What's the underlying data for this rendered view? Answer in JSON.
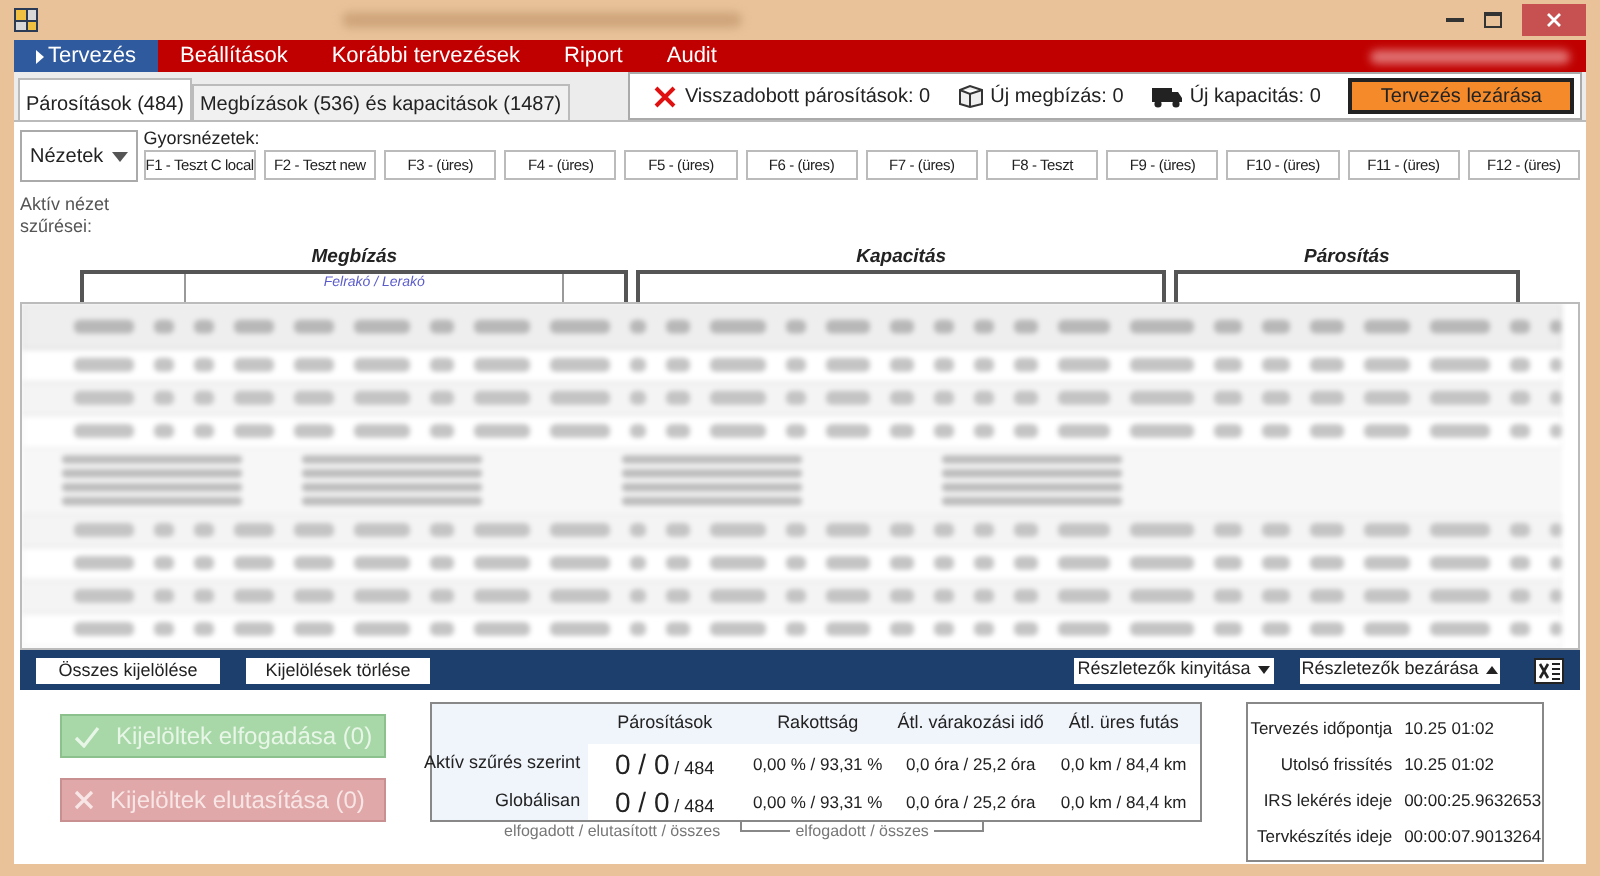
{
  "menu": [
    {
      "label": "Tervezés",
      "selected": true
    },
    {
      "label": "Beállítások",
      "selected": false
    },
    {
      "label": "Korábbi tervezések",
      "selected": false
    },
    {
      "label": "Riport",
      "selected": false
    },
    {
      "label": "Audit",
      "selected": false
    }
  ],
  "tabs": [
    {
      "label": "Párosítások (484)",
      "selected": true
    },
    {
      "label": "Megbízások (536) és kapacitások (1487)",
      "selected": false
    }
  ],
  "status": {
    "rejected": "Visszadobott párosítások: 0",
    "new_orders": "Új megbízás: 0",
    "new_capacity": "Új kapacitás: 0",
    "close_button": "Tervezés lezárása"
  },
  "views": {
    "dropdown": "Nézetek",
    "quick_label": "Gyorsnézetek:",
    "quick": [
      "F1 - Teszt C local",
      "F2 - Teszt new",
      "F3 - (üres)",
      "F4 - (üres)",
      "F5 - (üres)",
      "F6 - (üres)",
      "F7 - (üres)",
      "F8 - Teszt",
      "F9 - (üres)",
      "F10 - (üres)",
      "F11 - (üres)",
      "F12 - (üres)"
    ],
    "active_filters": "Aktív nézet szűrései:"
  },
  "groups": [
    "Megbízás",
    "Kapacitás",
    "Párosítás"
  ],
  "subgroup": "Felrakó / Lerakó",
  "toolbar": {
    "select_all": "Összes kijelölése",
    "clear_selection": "Kijelölések törlése",
    "expand": "Részletezők kinyitása",
    "collapse": "Részletezők bezárása"
  },
  "actions": [
    {
      "label": "Kijelöltek elfogadása (0)",
      "kind": "accept",
      "disabled": true
    },
    {
      "label": "Kijelöltek elutasítása (0)",
      "kind": "reject",
      "disabled": true
    }
  ],
  "stats": {
    "columns": [
      "Párosítások",
      "Rakottság",
      "Átl. várakozási idő",
      "Átl. üres futás"
    ],
    "rows": [
      {
        "label": "Aktív szűrés szerint",
        "count": "0 / 0",
        "total": "/ 484",
        "load": "0,00 % / 93,31 %",
        "wait": "0,0 óra / 25,2 óra",
        "empty": "0,0 km / 84,4 km"
      },
      {
        "label": "Globálisan",
        "count": "0 / 0",
        "total": "/ 484",
        "load": "0,00 % / 93,31 %",
        "wait": "0,0 óra / 25,2 óra",
        "empty": "0,0 km / 84,4 km"
      }
    ],
    "legend_left": "elfogadott / elutasított / összes",
    "legend_right": "elfogadott / összes"
  },
  "info": [
    {
      "label": "Tervezés időpontja",
      "value": "10.25 01:02"
    },
    {
      "label": "Utolsó frissítés",
      "value": "10.25 01:02"
    },
    {
      "label": "IRS lekérés ideje",
      "value": "00:00:25.9632653"
    },
    {
      "label": "Tervkészítés ideje",
      "value": "00:00:07.9013264"
    }
  ]
}
